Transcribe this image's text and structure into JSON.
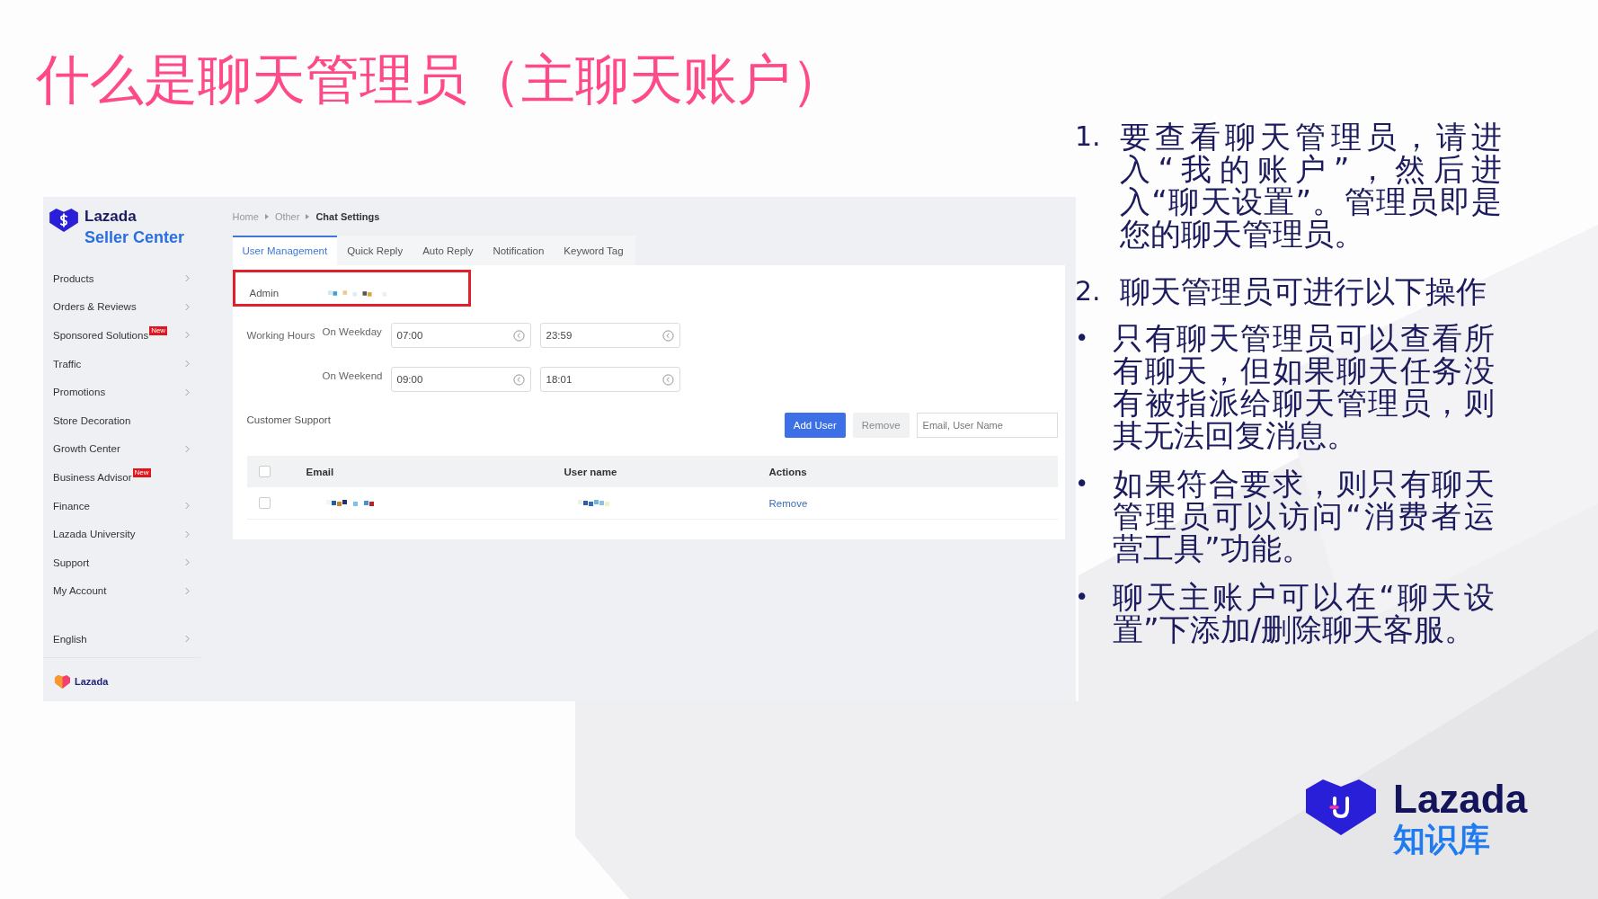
{
  "slide": {
    "title": "什么是聊天管理员（主聊天账户）"
  },
  "screenshot": {
    "brand": {
      "name": "Lazada",
      "subtitle": "Seller Center"
    },
    "sidebar": {
      "items": [
        {
          "label": "Products",
          "has_arrow": true
        },
        {
          "label": "Orders & Reviews",
          "has_arrow": true
        },
        {
          "label": "Sponsored Solutions",
          "badge": "New",
          "has_arrow": true
        },
        {
          "label": "Traffic",
          "has_arrow": true
        },
        {
          "label": "Promotions",
          "has_arrow": true
        },
        {
          "label": "Store Decoration",
          "has_arrow": false
        },
        {
          "label": "Growth Center",
          "has_arrow": true
        },
        {
          "label": "Business Advisor",
          "badge": "New",
          "has_arrow": false
        },
        {
          "label": "Finance",
          "has_arrow": true
        },
        {
          "label": "Lazada University",
          "has_arrow": true
        },
        {
          "label": "Support",
          "has_arrow": true
        },
        {
          "label": "My Account",
          "has_arrow": true
        }
      ],
      "language": {
        "label": "English",
        "has_arrow": true
      },
      "footer_logo": "Lazada"
    },
    "breadcrumb": [
      "Home",
      "Other",
      "Chat Settings"
    ],
    "tabs": [
      {
        "label": "User Management",
        "selected": true
      },
      {
        "label": "Quick Reply",
        "selected": false
      },
      {
        "label": "Auto Reply",
        "selected": false
      },
      {
        "label": "Notification",
        "selected": false
      },
      {
        "label": "Keyword Tag",
        "selected": false
      }
    ],
    "admin": {
      "label": "Admin",
      "highlighted": true
    },
    "working_hours": {
      "label": "Working Hours",
      "rows": [
        {
          "label": "On Weekday",
          "start": "07:00",
          "end": "23:59"
        },
        {
          "label": "On Weekend",
          "start": "09:00",
          "end": "18:01"
        }
      ]
    },
    "customer_support": {
      "label": "Customer Support",
      "buttons": [
        {
          "label": "Add User",
          "disabled": false
        },
        {
          "label": "Remove",
          "disabled": true
        }
      ],
      "search": {
        "placeholder": "Email, User Name"
      }
    },
    "table": {
      "all_checked": false,
      "columns": [
        "Email",
        "User name",
        "Actions"
      ],
      "rows": [
        {
          "checked": false,
          "action": "Remove"
        }
      ]
    }
  },
  "notes": [
    {
      "kind": "numbered",
      "marker": "1.",
      "text": "要查看聊天管理员，请进入“我的账户”，然后进入“聊天设置”。管理员即是您的聊天管理员。"
    },
    {
      "kind": "numbered",
      "marker": "2.",
      "text": "聊天管理员可进行以下操作"
    },
    {
      "kind": "bullet",
      "marker": "•",
      "text": "只有聊天管理员可以查看所有聊天，但如果聊天任务没有被指派给聊天管理员，则其无法回复消息。"
    },
    {
      "kind": "bullet",
      "marker": "•",
      "text": "如果符合要求，则只有聊天管理员可以访问“消费者运营工具”功能。"
    },
    {
      "kind": "bullet",
      "marker": "•",
      "text": "聊天主账户可以在“聊天设置”下添加/删除聊天客服。"
    }
  ],
  "logo": {
    "name": "Lazada",
    "subtitle": "知识库"
  }
}
